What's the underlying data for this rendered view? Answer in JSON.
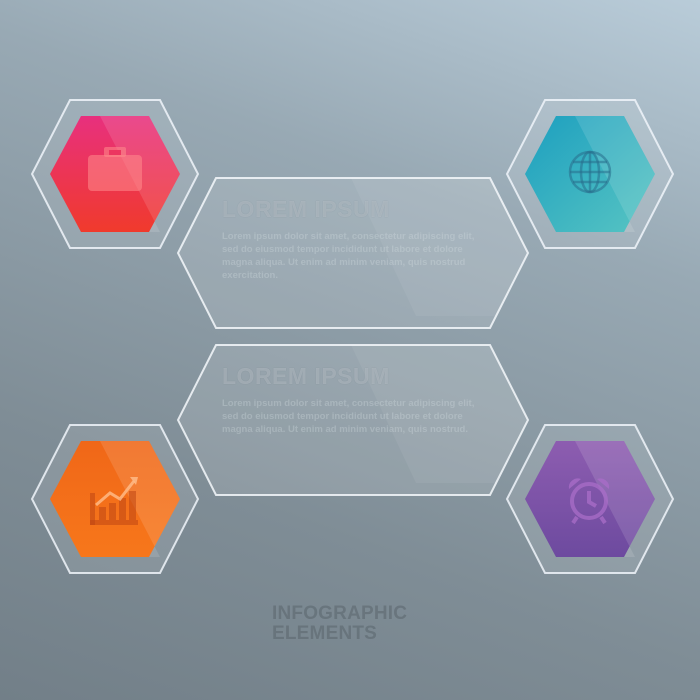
{
  "blocks": [
    {
      "title": "LOREM IPSUM",
      "body": "Lorem ipsum dolor sit amet, consectetur adipiscing elit, sed do eiusmod tempor incididunt ut labore et dolore magna aliqua. Ut enim ad minim veniam, quis nostrud exercitation."
    },
    {
      "title": "LOREM IPSUM",
      "body": "Lorem ipsum dolor sit amet, consectetur adipiscing elit, sed do eiusmod tempor incididunt ut labore et dolore magna aliqua. Ut enim ad minim veniam, quis nostrud."
    }
  ],
  "hexagons": [
    {
      "icon": "briefcase-icon",
      "color_top": "#e9327f",
      "color_bottom": "#ef3b2e"
    },
    {
      "icon": "globe-icon",
      "color_top": "#1fa6c1",
      "color_bottom": "#5fc8c4"
    },
    {
      "icon": "chart-icon",
      "color_top": "#f06a1c",
      "color_bottom": "#f7761a"
    },
    {
      "icon": "alarm-clock-icon",
      "color_top": "#8a5cae",
      "color_bottom": "#6f4aa0"
    }
  ],
  "footer": {
    "line1": "INFOGRAPHIC",
    "line2": "ELEMENTS"
  }
}
